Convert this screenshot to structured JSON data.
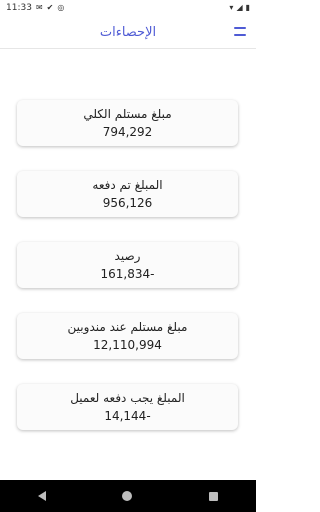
{
  "status_bar": {
    "time": "11:33",
    "icons": [
      "mail-icon",
      "check-icon",
      "sync-icon",
      "wifi-icon",
      "signal-icon",
      "battery-icon"
    ]
  },
  "app_bar": {
    "title": "الإحصاءات",
    "menu_icon": "menu-icon",
    "accent_color": "#4f5bd5"
  },
  "cards": [
    {
      "label": "مبلغ مستلم الكلي",
      "value": "794,292"
    },
    {
      "label": "المبلغ تم دفعه",
      "value": "956,126"
    },
    {
      "label": "رصيد",
      "value": "161,834-"
    },
    {
      "label": "مبلغ مستلم عند مندوبين",
      "value": "12,110,994"
    },
    {
      "label": "المبلغ يجب دفعه لعميل",
      "value": "14,144-"
    }
  ],
  "nav_bar": {
    "icons": [
      "back-icon",
      "home-icon",
      "recents-icon"
    ]
  }
}
